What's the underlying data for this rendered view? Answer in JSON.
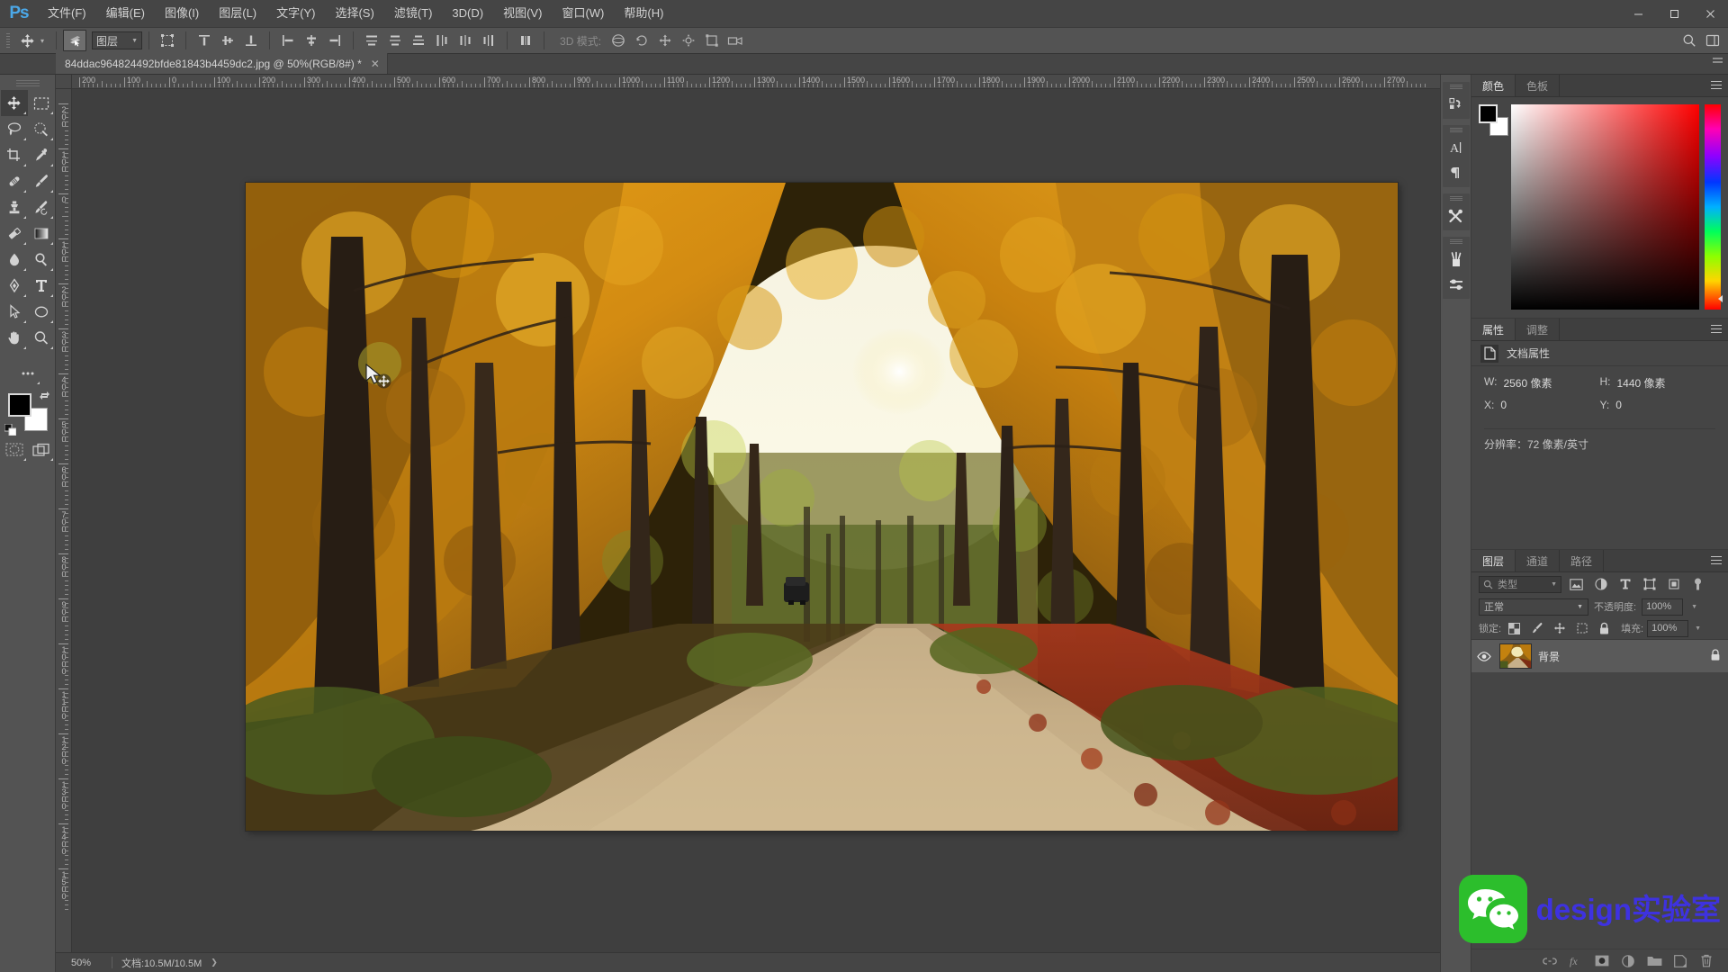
{
  "app": {
    "logo": "Ps",
    "menu": [
      {
        "label": "文件(F)",
        "name": "menu-file"
      },
      {
        "label": "编辑(E)",
        "name": "menu-edit"
      },
      {
        "label": "图像(I)",
        "name": "menu-image"
      },
      {
        "label": "图层(L)",
        "name": "menu-layer"
      },
      {
        "label": "文字(Y)",
        "name": "menu-type"
      },
      {
        "label": "选择(S)",
        "name": "menu-select"
      },
      {
        "label": "滤镜(T)",
        "name": "menu-filter"
      },
      {
        "label": "3D(D)",
        "name": "menu-3d"
      },
      {
        "label": "视图(V)",
        "name": "menu-view"
      },
      {
        "label": "窗口(W)",
        "name": "menu-window"
      },
      {
        "label": "帮助(H)",
        "name": "menu-help"
      }
    ],
    "window_controls": {
      "minimize": "—",
      "maximize": "▫",
      "close": "✕"
    }
  },
  "options_bar": {
    "tool": "move-tool",
    "auto_select_label": "",
    "layer_select_value": "图层",
    "mode_3d_label": "3D 模式:",
    "align_group_1": [
      "align-top-edges",
      "align-vertical-centers",
      "align-bottom-edges"
    ],
    "align_group_2": [
      "align-left-edges",
      "align-horizontal-centers",
      "align-right-edges"
    ],
    "distribute_group": [
      "distribute-top",
      "distribute-vertical-center",
      "distribute-bottom",
      "distribute-left",
      "distribute-horizontal-center",
      "distribute-right"
    ]
  },
  "document": {
    "tab_title": "84ddac964824492bfde81843b4459dc2.jpg @ 50%(RGB/8#) *",
    "close_glyph": "✕",
    "zoom": "50%",
    "status_doc": "文档:10.5M/10.5M",
    "status_arrow": "❯"
  },
  "rulers": {
    "unit": "px",
    "h_labels": [
      "200",
      "100",
      "0",
      "100",
      "200",
      "300",
      "400",
      "500",
      "600",
      "700",
      "800",
      "900",
      "1000",
      "1100",
      "1200",
      "1300",
      "1400",
      "1500",
      "1600",
      "1700",
      "1800",
      "1900",
      "2000",
      "2100",
      "2200",
      "2300",
      "2400",
      "2500",
      "2600",
      "2700"
    ],
    "v_labels": [
      "2 0 0",
      "1 0 0",
      "0",
      "1 0 0",
      "2 0 0",
      "3 0 0",
      "4 0 0",
      "5 0 0",
      "6 0 0",
      "7 0 0",
      "8 0 0",
      "9 0 0",
      "1 0 0 0",
      "1 1 0 0",
      "1 2 0 0",
      "1 3 0 0",
      "1 4 0 0",
      "1 5 0 0"
    ]
  },
  "toolbar": {
    "tools": [
      {
        "name": "move-tool",
        "label": "移动工具",
        "active": true
      },
      {
        "name": "rectangular-marquee-tool",
        "label": "矩形选框工具",
        "active": false
      },
      {
        "name": "lasso-tool",
        "label": "套索工具",
        "active": false
      },
      {
        "name": "quick-selection-tool",
        "label": "快速选择工具",
        "active": false
      },
      {
        "name": "crop-tool",
        "label": "裁剪工具",
        "active": false
      },
      {
        "name": "eyedropper-tool",
        "label": "吸管工具",
        "active": false
      },
      {
        "name": "healing-brush-tool",
        "label": "污点修复画笔工具",
        "active": false
      },
      {
        "name": "brush-tool",
        "label": "画笔工具",
        "active": false
      },
      {
        "name": "clone-stamp-tool",
        "label": "仿制图章工具",
        "active": false
      },
      {
        "name": "history-brush-tool",
        "label": "历史记录画笔工具",
        "active": false
      },
      {
        "name": "eraser-tool",
        "label": "橡皮擦工具",
        "active": false
      },
      {
        "name": "gradient-tool",
        "label": "渐变工具",
        "active": false
      },
      {
        "name": "blur-tool",
        "label": "模糊工具",
        "active": false
      },
      {
        "name": "dodge-tool",
        "label": "减淡工具",
        "active": false
      },
      {
        "name": "pen-tool",
        "label": "钢笔工具",
        "active": false
      },
      {
        "name": "horizontal-type-tool",
        "label": "横排文字工具",
        "active": false
      },
      {
        "name": "path-selection-tool",
        "label": "路径选择工具",
        "active": false
      },
      {
        "name": "ellipse-tool",
        "label": "椭圆工具",
        "active": false
      },
      {
        "name": "hand-tool",
        "label": "抓手工具",
        "active": false
      },
      {
        "name": "zoom-tool",
        "label": "缩放工具",
        "active": false
      },
      {
        "name": "edit-toolbar-more",
        "label": "更多",
        "active": false
      }
    ],
    "foreground_color": "#000000",
    "background_color": "#ffffff",
    "bottom": [
      {
        "name": "quick-mask-toggle",
        "label": "以快速蒙版模式编辑"
      },
      {
        "name": "screen-mode-toggle",
        "label": "更改屏幕模式"
      }
    ]
  },
  "rail": [
    {
      "name": "history-panel-icon",
      "glyph": "history"
    },
    {
      "name": "character-panel-icon",
      "glyph": "A|"
    },
    {
      "name": "paragraph-panel-icon",
      "glyph": "¶"
    },
    {
      "name": "tool-presets-icon",
      "glyph": "x-tools"
    },
    {
      "name": "brush-presets-icon",
      "glyph": "brush-jar"
    },
    {
      "name": "adjustments-icon",
      "glyph": "sliders"
    }
  ],
  "color_panel": {
    "tabs": [
      {
        "label": "颜色",
        "active": true
      },
      {
        "label": "色板",
        "active": false
      }
    ],
    "foreground": "#000000",
    "background": "#ffffff",
    "hue": "#ff0000"
  },
  "properties_panel": {
    "tabs": [
      {
        "label": "属性",
        "active": true
      },
      {
        "label": "调整",
        "active": false
      }
    ],
    "header": "文档属性",
    "fields": [
      {
        "key": "W:",
        "value": "2560 像素"
      },
      {
        "key": "H:",
        "value": "1440 像素"
      },
      {
        "key": "X:",
        "value": "0"
      },
      {
        "key": "Y:",
        "value": "0"
      }
    ],
    "resolution": "分辨率：72 像素/英寸"
  },
  "layers_panel": {
    "tabs": [
      {
        "label": "图层",
        "active": true
      },
      {
        "label": "通道",
        "active": false
      },
      {
        "label": "路径",
        "active": false
      }
    ],
    "filter_placeholder": "类型",
    "filter_icons": [
      "filter-pixel-icon",
      "filter-adjustment-icon",
      "filter-type-icon",
      "filter-shape-icon",
      "filter-smart-object-icon",
      "filter-toggle-icon"
    ],
    "blend_mode": "正常",
    "opacity_label": "不透明度:",
    "opacity_value": "100%",
    "lock_label": "锁定:",
    "lock_icons": [
      "lock-transparent-pixels-icon",
      "lock-image-pixels-icon",
      "lock-position-icon",
      "lock-artboard-icon",
      "lock-all-icon"
    ],
    "fill_label": "填充:",
    "fill_value": "100%",
    "layers": [
      {
        "name": "背景",
        "visible": true,
        "locked": true,
        "selected": true
      }
    ],
    "footer_buttons": [
      {
        "name": "link-layers-button",
        "glyph": "link"
      },
      {
        "name": "layer-style-button",
        "glyph": "fx"
      },
      {
        "name": "layer-mask-button",
        "glyph": "mask"
      },
      {
        "name": "adjustment-layer-button",
        "glyph": "halfcircle"
      },
      {
        "name": "new-group-button",
        "glyph": "folder"
      },
      {
        "name": "new-layer-button",
        "glyph": "newlayer"
      },
      {
        "name": "delete-layer-button",
        "glyph": "trash"
      }
    ]
  },
  "watermark": {
    "text": "design实验室",
    "logo_color": "#2cbe2c",
    "text_color": "#3e32e0"
  }
}
